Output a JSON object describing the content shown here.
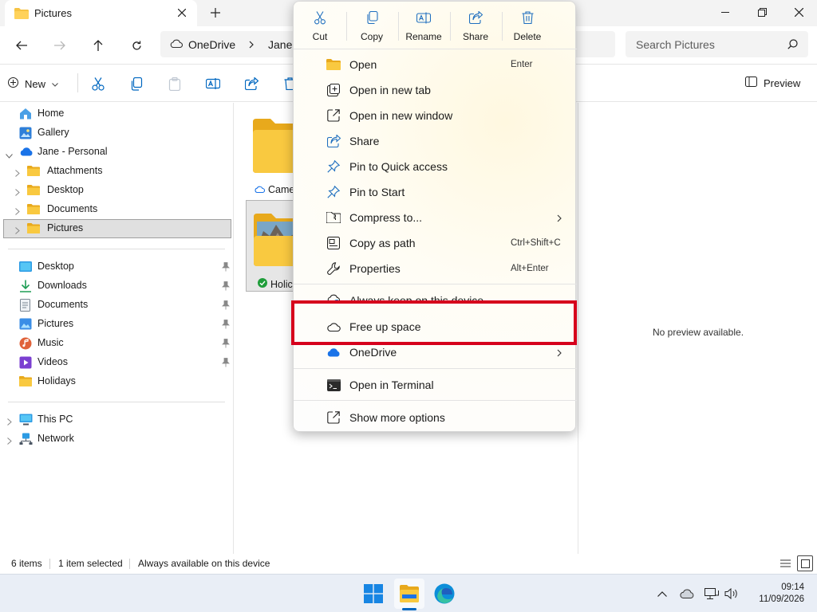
{
  "window": {
    "tab_title": "Pictures",
    "close_tab_icon": "close-icon",
    "new_tab_icon": "plus-icon"
  },
  "address": {
    "crumbs": [
      "OneDrive",
      "Jane"
    ],
    "search_placeholder": "Search Pictures"
  },
  "toolbar": {
    "new_label": "New",
    "preview_label": "Preview"
  },
  "navigation": {
    "tree": [
      {
        "label": "Home",
        "icon": "home-icon"
      },
      {
        "label": "Gallery",
        "icon": "gallery-icon"
      },
      {
        "label": "Jane - Personal",
        "icon": "onedrive-icon"
      },
      {
        "label": "Attachments",
        "icon": "folder-icon"
      },
      {
        "label": "Desktop",
        "icon": "folder-icon"
      },
      {
        "label": "Documents",
        "icon": "folder-icon"
      },
      {
        "label": "Pictures",
        "icon": "folder-icon"
      }
    ],
    "quick_access": [
      {
        "label": "Desktop",
        "icon": "desktop-icon"
      },
      {
        "label": "Downloads",
        "icon": "download-icon"
      },
      {
        "label": "Documents",
        "icon": "document-icon"
      },
      {
        "label": "Pictures",
        "icon": "pictures-icon"
      },
      {
        "label": "Music",
        "icon": "music-icon"
      },
      {
        "label": "Videos",
        "icon": "videos-icon"
      },
      {
        "label": "Holidays",
        "icon": "folder-icon"
      }
    ],
    "locations": [
      {
        "label": "This PC",
        "icon": "pc-icon"
      },
      {
        "label": "Network",
        "icon": "network-icon"
      }
    ]
  },
  "content": {
    "tiles": [
      {
        "label": "Came",
        "status_icon": "cloud-icon"
      },
      {
        "label": "Holic",
        "status_icon": "check-icon"
      }
    ]
  },
  "preview": {
    "message": "No preview available."
  },
  "status": {
    "items": "6 items",
    "selected": "1 item selected",
    "availability": "Always available on this device"
  },
  "context_menu": {
    "top_actions": [
      {
        "label": "Cut",
        "icon": "cut-icon"
      },
      {
        "label": "Copy",
        "icon": "copy-icon"
      },
      {
        "label": "Rename",
        "icon": "rename-icon"
      },
      {
        "label": "Share",
        "icon": "share-icon"
      },
      {
        "label": "Delete",
        "icon": "delete-icon"
      }
    ],
    "items": [
      {
        "label": "Open",
        "shortcut": "Enter",
        "icon": "folder-icon"
      },
      {
        "label": "Open in new tab",
        "shortcut": "",
        "icon": "new-tab-icon"
      },
      {
        "label": "Open in new window",
        "shortcut": "",
        "icon": "new-window-icon"
      },
      {
        "label": "Share",
        "shortcut": "",
        "icon": "share-icon"
      },
      {
        "label": "Pin to Quick access",
        "shortcut": "",
        "icon": "pin-icon"
      },
      {
        "label": "Pin to Start",
        "shortcut": "",
        "icon": "pin-icon"
      },
      {
        "label": "Compress to...",
        "shortcut": "",
        "icon": "zip-icon"
      },
      {
        "label": "Copy as path",
        "shortcut": "Ctrl+Shift+C",
        "icon": "copy-path-icon"
      },
      {
        "label": "Properties",
        "shortcut": "Alt+Enter",
        "icon": "wrench-icon"
      },
      {
        "label": "Always keep on this device",
        "shortcut": "",
        "icon": "cloud-sync-icon"
      },
      {
        "label": "Free up space",
        "shortcut": "",
        "icon": "cloud-icon"
      },
      {
        "label": "OneDrive",
        "shortcut": "",
        "icon": "onedrive-icon"
      },
      {
        "label": "Open in Terminal",
        "shortcut": "",
        "icon": "terminal-icon"
      },
      {
        "label": "Show more options",
        "shortcut": "",
        "icon": "more-options-icon"
      }
    ]
  },
  "taskbar": {
    "time": "09:14",
    "date": "11/09/2026"
  },
  "colors": {
    "highlight": "#d6001c",
    "accent": "#0067c0",
    "folder": "#f6c344",
    "onedrive": "#1a73e8"
  }
}
